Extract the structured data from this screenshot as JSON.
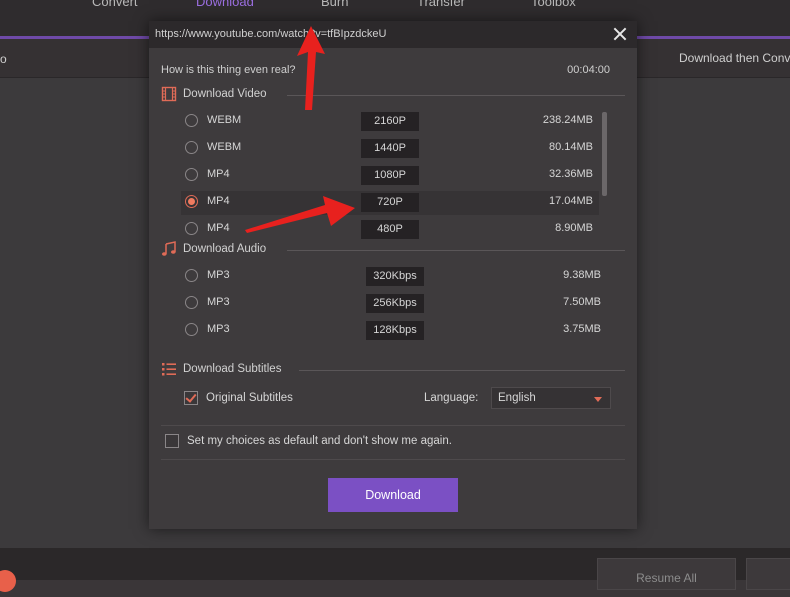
{
  "app": {
    "tabs": [
      {
        "label": "Convert"
      },
      {
        "label": "Download"
      },
      {
        "label": "Burn"
      },
      {
        "label": "Transfer"
      },
      {
        "label": "Toolbox"
      }
    ],
    "active_tab": "Download",
    "subbar_left": "o",
    "subbar_right": "Download then Conv",
    "bottom_button": "Resume All"
  },
  "dialog": {
    "url": "https://www.youtube.com/watch?v=tfBIpzdckeU",
    "video_title": "How is this thing even real?",
    "duration": "00:04:00",
    "video_section": {
      "label": "Download Video",
      "options": [
        {
          "format": "WEBM",
          "quality": "2160P",
          "size": "238.24MB",
          "selected": false
        },
        {
          "format": "WEBM",
          "quality": "1440P",
          "size": "80.14MB",
          "selected": false
        },
        {
          "format": "MP4",
          "quality": "1080P",
          "size": "32.36MB",
          "selected": false
        },
        {
          "format": "MP4",
          "quality": "720P",
          "size": "17.04MB",
          "selected": true
        },
        {
          "format": "MP4",
          "quality": "480P",
          "size": "8.90MB",
          "selected": false
        }
      ]
    },
    "audio_section": {
      "label": "Download Audio",
      "options": [
        {
          "format": "MP3",
          "quality": "320Kbps",
          "size": "9.38MB",
          "selected": false
        },
        {
          "format": "MP3",
          "quality": "256Kbps",
          "size": "7.50MB",
          "selected": false
        },
        {
          "format": "MP3",
          "quality": "128Kbps",
          "size": "3.75MB",
          "selected": false
        }
      ]
    },
    "subtitle_section": {
      "label": "Download Subtitles",
      "original_subtitles_label": "Original Subtitles",
      "original_subtitles_checked": true,
      "language_label": "Language:",
      "language_value": "English"
    },
    "default_choice_label": "Set my choices as default and don't show me again.",
    "default_choice_checked": false,
    "download_label": "Download"
  },
  "colors": {
    "accent_purple": "#7b50c4",
    "accent_orange": "#e06b57",
    "annotation_red": "#e8211e"
  }
}
